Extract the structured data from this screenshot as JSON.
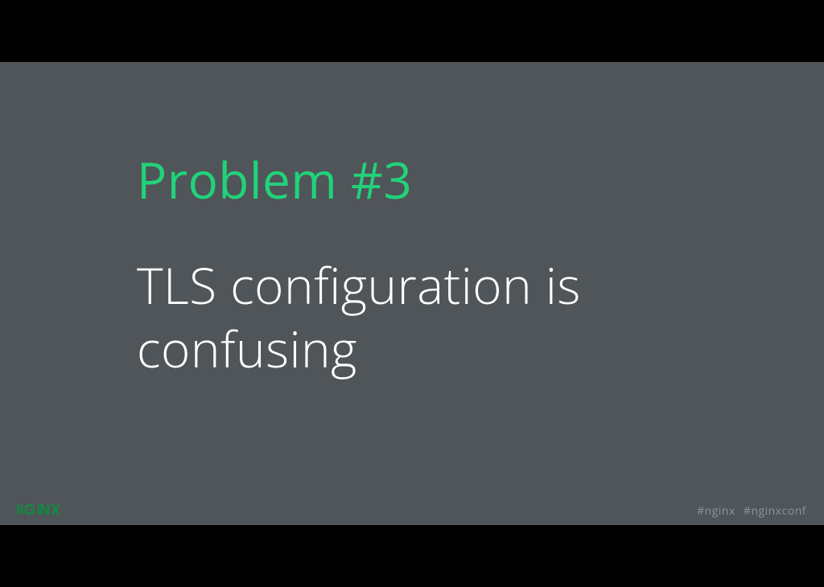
{
  "slide": {
    "title": "Problem #3",
    "body": "TLS configuration is confusing"
  },
  "footer": {
    "logo_text": "NGINX",
    "hashtags": "#nginx  #nginxconf"
  },
  "colors": {
    "background": "#4f5559",
    "accent": "#21d27a",
    "body_text": "#ffffff",
    "logo": "#0c8f3f",
    "hashtag": "#8d9498"
  }
}
